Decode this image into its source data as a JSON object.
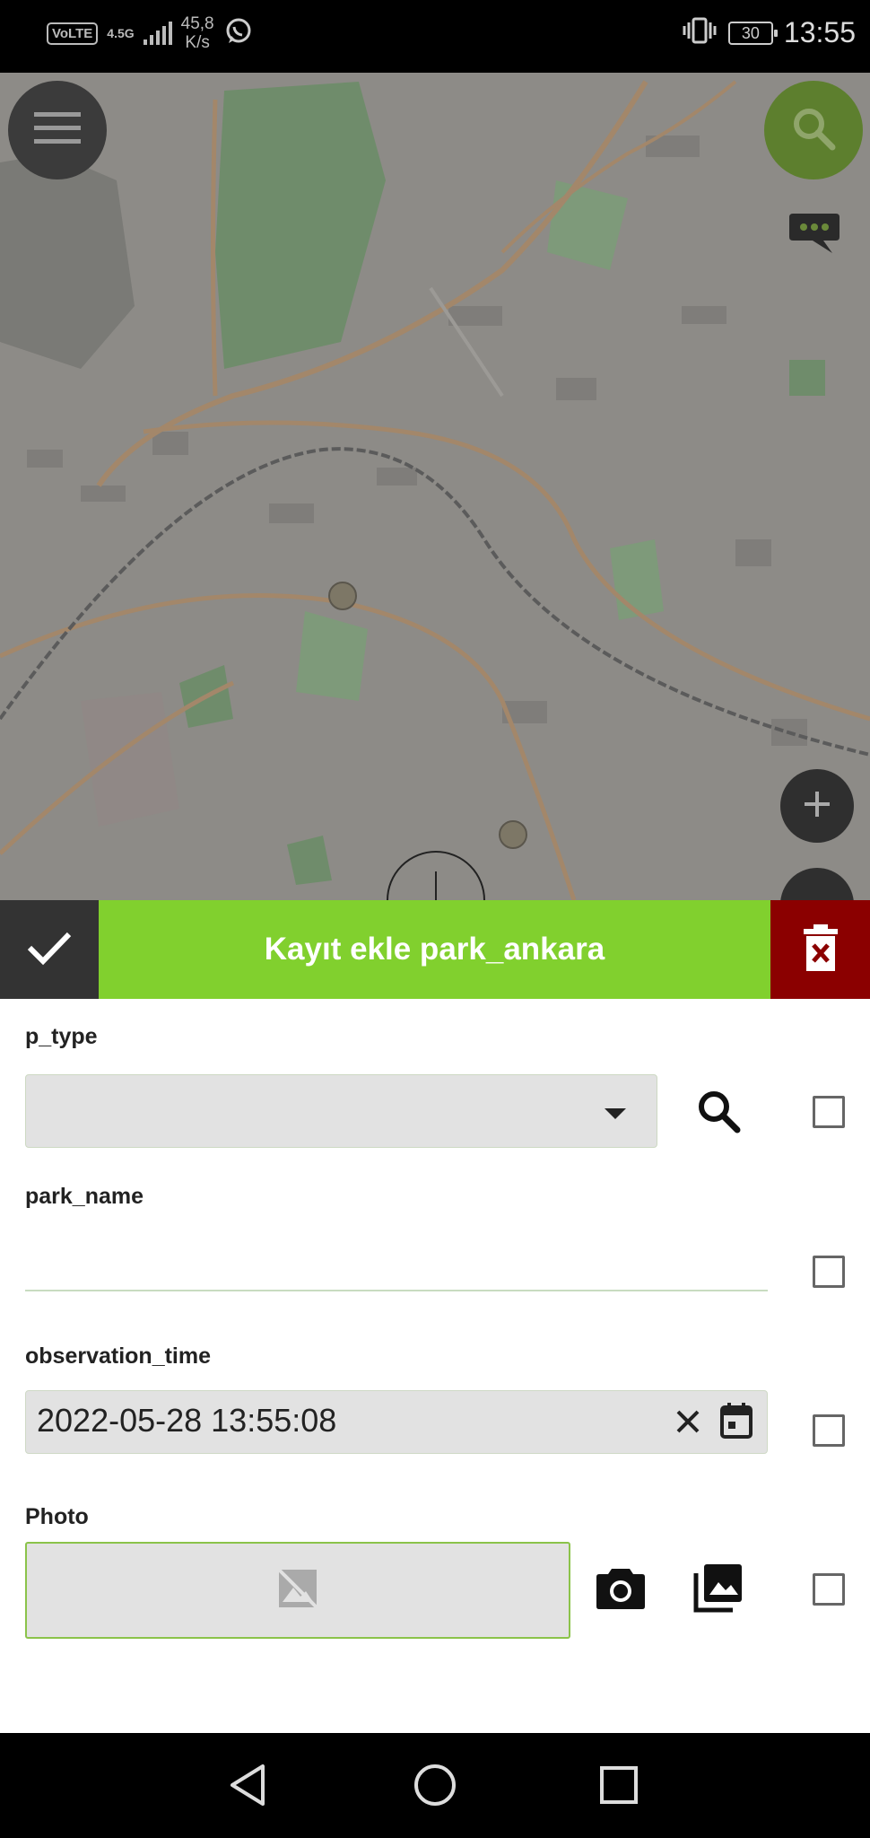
{
  "status_bar": {
    "volte": "VoLTE",
    "network": "4.5G",
    "speed_value": "45,8",
    "speed_unit": "K/s",
    "battery": "30",
    "time": "13:55"
  },
  "map": {
    "menu_button": "menu-icon",
    "search_button": "search-icon",
    "chat_bubble": "chat-bubble-icon",
    "zoom_in_button": "plus-icon",
    "zoom_out_button": "minus-icon"
  },
  "form": {
    "title": "Kayıt ekle park_ankara",
    "colors": {
      "header_green": "#81d02e",
      "confirm_dark": "#333333",
      "delete_red": "#8b0000"
    },
    "fields": {
      "p_type": {
        "label": "p_type",
        "value": ""
      },
      "park_name": {
        "label": "park_name",
        "value": ""
      },
      "observation_time": {
        "label": "observation_time",
        "value": "2022-05-28 13:55:08"
      },
      "photo": {
        "label": "Photo"
      }
    }
  },
  "nav_bar": {
    "back": "back-icon",
    "home": "home-icon",
    "recents": "recents-icon"
  }
}
